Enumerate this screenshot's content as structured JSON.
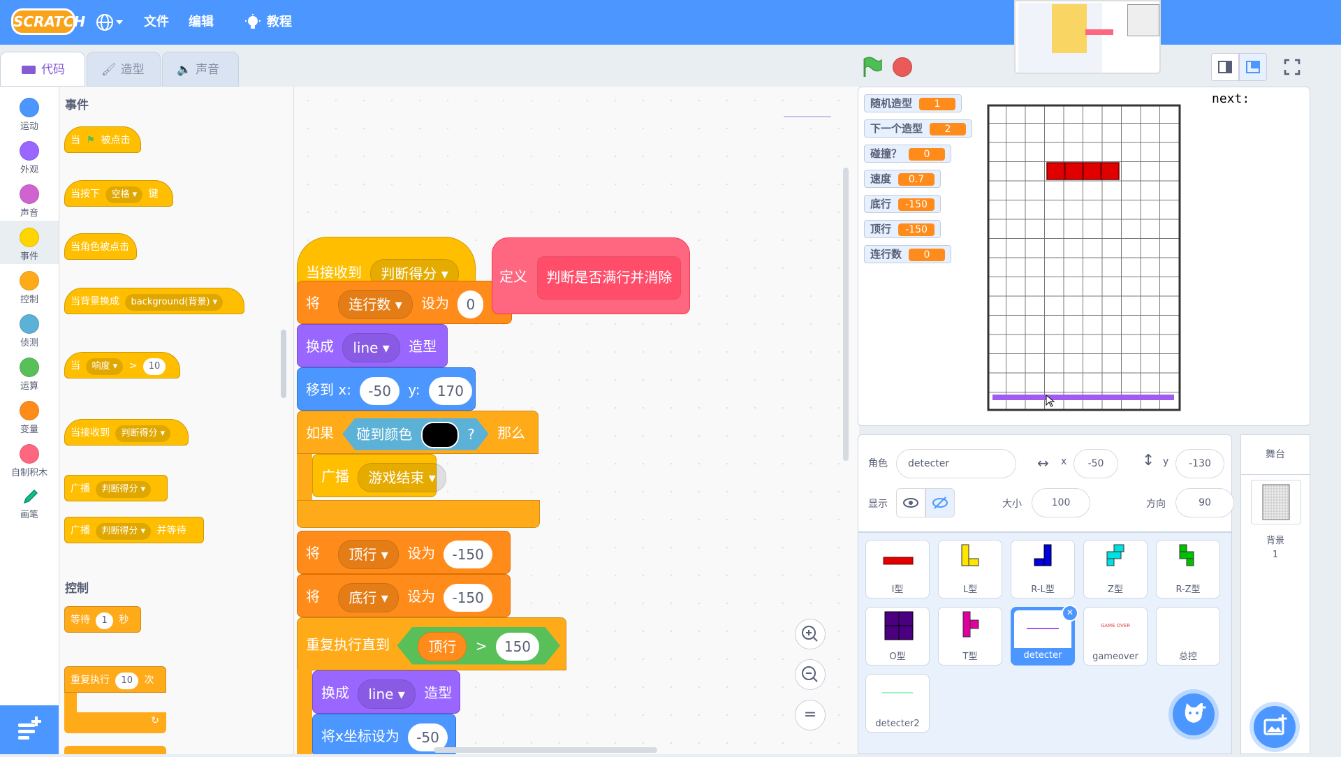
{
  "menu": {
    "logo": "SCRATCH",
    "file": "文件",
    "edit": "编辑",
    "tutorial": "教程"
  },
  "tabs": {
    "code": "代码",
    "costume": "造型",
    "sound": "声音"
  },
  "categories": [
    {
      "label": "运动",
      "color": "#4c97ff"
    },
    {
      "label": "外观",
      "color": "#9966ff"
    },
    {
      "label": "声音",
      "color": "#cf63cf"
    },
    {
      "label": "事件",
      "color": "#ffd500"
    },
    {
      "label": "控制",
      "color": "#ffab19"
    },
    {
      "label": "侦测",
      "color": "#5cb1d6"
    },
    {
      "label": "运算",
      "color": "#59c059"
    },
    {
      "label": "变量",
      "color": "#ff8c1a"
    },
    {
      "label": "自制积木",
      "color": "#ff6680"
    },
    {
      "label": "画笔",
      "color": "#0fbd8c"
    }
  ],
  "palette": {
    "events_head": "事件",
    "when_flag_a": "当",
    "when_flag_b": "被点击",
    "when_key_a": "当按下",
    "when_key_dd": "空格",
    "when_key_b": "键",
    "when_sprite": "当角色被点击",
    "when_bg_a": "当背景换成",
    "when_bg_dd": "background(背景)",
    "when_gt_a": "当",
    "when_gt_dd": "响度",
    "when_gt_op": ">",
    "when_gt_val": "10",
    "when_recv_a": "当接收到",
    "when_recv_dd": "判断得分",
    "bcast_a": "广播",
    "bcast_dd": "判断得分",
    "bcastw_a": "广播",
    "bcastw_dd": "判断得分",
    "bcastw_b": "并等待",
    "control_head": "控制",
    "wait_a": "等待",
    "wait_val": "1",
    "wait_b": "秒",
    "repeat_a": "重复执行",
    "repeat_val": "10",
    "repeat_b": "次"
  },
  "script": {
    "recv_a": "当接收到",
    "recv_dd": "判断得分",
    "set1_a": "将",
    "set1_dd": "连行数",
    "set1_b": "设为",
    "set1_val": "0",
    "sw1_a": "换成",
    "sw1_dd": "line",
    "sw1_b": "造型",
    "goto_a": "移到 x:",
    "goto_x": "-50",
    "goto_b": "y:",
    "goto_y": "170",
    "if_a": "如果",
    "if_cond": "碰到颜色",
    "if_q": "?",
    "if_b": "那么",
    "bc_a": "广播",
    "bc_dd": "游戏结束",
    "set2_a": "将",
    "set2_dd": "顶行",
    "set2_b": "设为",
    "set2_val": "-150",
    "set3_a": "将",
    "set3_dd": "底行",
    "set3_b": "设为",
    "set3_val": "-150",
    "rep_a": "重复执行直到",
    "rep_var": "顶行",
    "rep_op": ">",
    "rep_val": "150",
    "sw2_a": "换成",
    "sw2_dd": "line",
    "sw2_b": "造型",
    "setx_a": "将x坐标设为",
    "setx_val": "-50",
    "def_a": "定义",
    "def_name": "判断是否满行并消除",
    "zoom_eq": "="
  },
  "stage": {
    "next_label": "next:",
    "monitors": [
      {
        "label": "随机造型",
        "value": "1"
      },
      {
        "label": "下一个造型",
        "value": "2"
      },
      {
        "label": "碰撞？",
        "value": "0"
      },
      {
        "label": "速度",
        "value": "0.7"
      },
      {
        "label": "底行",
        "value": "-150"
      },
      {
        "label": "顶行",
        "value": "-150"
      },
      {
        "label": "连行数",
        "value": "0"
      }
    ]
  },
  "sprite_info": {
    "sprite_label": "角色",
    "sprite_name": "detecter",
    "x_label": "x",
    "x_val": "-50",
    "y_label": "y",
    "y_val": "-130",
    "show_label": "显示",
    "size_label": "大小",
    "size_val": "100",
    "dir_label": "方向",
    "dir_val": "90"
  },
  "sprites": [
    "I型",
    "L型",
    "R-L型",
    "Z型",
    "R-Z型",
    "O型",
    "T型",
    "detecter",
    "gameover",
    "总控",
    "detecter2"
  ],
  "gameover_thumb": "GAME OVER",
  "stage_panel": {
    "title": "舞台",
    "bg_label": "背景",
    "bg_count": "1"
  }
}
